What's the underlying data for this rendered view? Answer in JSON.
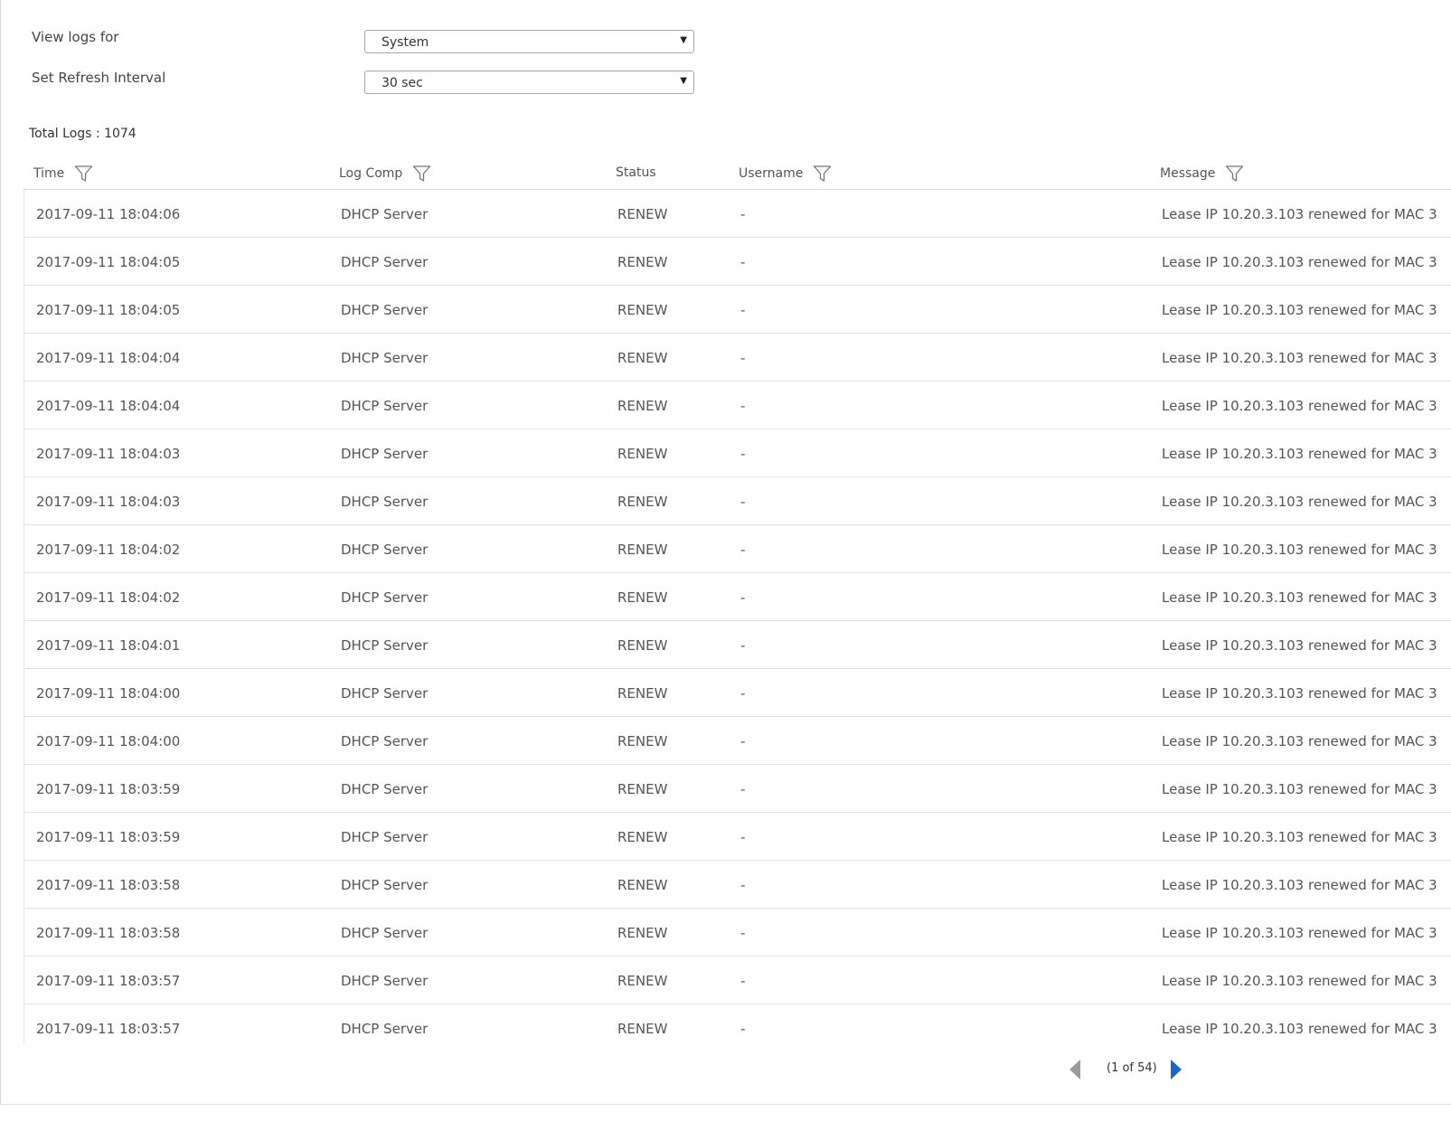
{
  "form": {
    "view_logs_label": "View logs for",
    "view_logs_value": "System",
    "refresh_label": "Set Refresh Interval",
    "refresh_value": "30 sec"
  },
  "summary": {
    "total_logs": "Total Logs : 1074"
  },
  "table": {
    "columns": [
      "Time",
      "Log Comp",
      "Status",
      "Username",
      "Message"
    ],
    "rows": [
      {
        "time": "2017-09-11 18:04:06",
        "log_comp": "DHCP Server",
        "status": "RENEW",
        "username": "-",
        "message": "Lease IP 10.20.3.103 renewed for MAC 3"
      },
      {
        "time": "2017-09-11 18:04:05",
        "log_comp": "DHCP Server",
        "status": "RENEW",
        "username": "-",
        "message": "Lease IP 10.20.3.103 renewed for MAC 3"
      },
      {
        "time": "2017-09-11 18:04:05",
        "log_comp": "DHCP Server",
        "status": "RENEW",
        "username": "-",
        "message": "Lease IP 10.20.3.103 renewed for MAC 3"
      },
      {
        "time": "2017-09-11 18:04:04",
        "log_comp": "DHCP Server",
        "status": "RENEW",
        "username": "-",
        "message": "Lease IP 10.20.3.103 renewed for MAC 3"
      },
      {
        "time": "2017-09-11 18:04:04",
        "log_comp": "DHCP Server",
        "status": "RENEW",
        "username": "-",
        "message": "Lease IP 10.20.3.103 renewed for MAC 3"
      },
      {
        "time": "2017-09-11 18:04:03",
        "log_comp": "DHCP Server",
        "status": "RENEW",
        "username": "-",
        "message": "Lease IP 10.20.3.103 renewed for MAC 3"
      },
      {
        "time": "2017-09-11 18:04:03",
        "log_comp": "DHCP Server",
        "status": "RENEW",
        "username": "-",
        "message": "Lease IP 10.20.3.103 renewed for MAC 3"
      },
      {
        "time": "2017-09-11 18:04:02",
        "log_comp": "DHCP Server",
        "status": "RENEW",
        "username": "-",
        "message": "Lease IP 10.20.3.103 renewed for MAC 3"
      },
      {
        "time": "2017-09-11 18:04:02",
        "log_comp": "DHCP Server",
        "status": "RENEW",
        "username": "-",
        "message": "Lease IP 10.20.3.103 renewed for MAC 3"
      },
      {
        "time": "2017-09-11 18:04:01",
        "log_comp": "DHCP Server",
        "status": "RENEW",
        "username": "-",
        "message": "Lease IP 10.20.3.103 renewed for MAC 3"
      },
      {
        "time": "2017-09-11 18:04:00",
        "log_comp": "DHCP Server",
        "status": "RENEW",
        "username": "-",
        "message": "Lease IP 10.20.3.103 renewed for MAC 3"
      },
      {
        "time": "2017-09-11 18:04:00",
        "log_comp": "DHCP Server",
        "status": "RENEW",
        "username": "-",
        "message": "Lease IP 10.20.3.103 renewed for MAC 3"
      },
      {
        "time": "2017-09-11 18:03:59",
        "log_comp": "DHCP Server",
        "status": "RENEW",
        "username": "-",
        "message": "Lease IP 10.20.3.103 renewed for MAC 3"
      },
      {
        "time": "2017-09-11 18:03:59",
        "log_comp": "DHCP Server",
        "status": "RENEW",
        "username": "-",
        "message": "Lease IP 10.20.3.103 renewed for MAC 3"
      },
      {
        "time": "2017-09-11 18:03:58",
        "log_comp": "DHCP Server",
        "status": "RENEW",
        "username": "-",
        "message": "Lease IP 10.20.3.103 renewed for MAC 3"
      },
      {
        "time": "2017-09-11 18:03:58",
        "log_comp": "DHCP Server",
        "status": "RENEW",
        "username": "-",
        "message": "Lease IP 10.20.3.103 renewed for MAC 3"
      },
      {
        "time": "2017-09-11 18:03:57",
        "log_comp": "DHCP Server",
        "status": "RENEW",
        "username": "-",
        "message": "Lease IP 10.20.3.103 renewed for MAC 3"
      },
      {
        "time": "2017-09-11 18:03:57",
        "log_comp": "DHCP Server",
        "status": "RENEW",
        "username": "-",
        "message": "Lease IP 10.20.3.103 renewed for MAC 3"
      }
    ]
  },
  "pagination": {
    "text": "(1 of 54)"
  },
  "icons": {
    "filter": "filter-icon",
    "dropdown": "chevron-down-icon",
    "prev": "prev-page-icon",
    "next": "next-page-icon"
  },
  "colors": {
    "next_arrow": "#1a66c7",
    "prev_arrow": "#9a9a9a"
  }
}
